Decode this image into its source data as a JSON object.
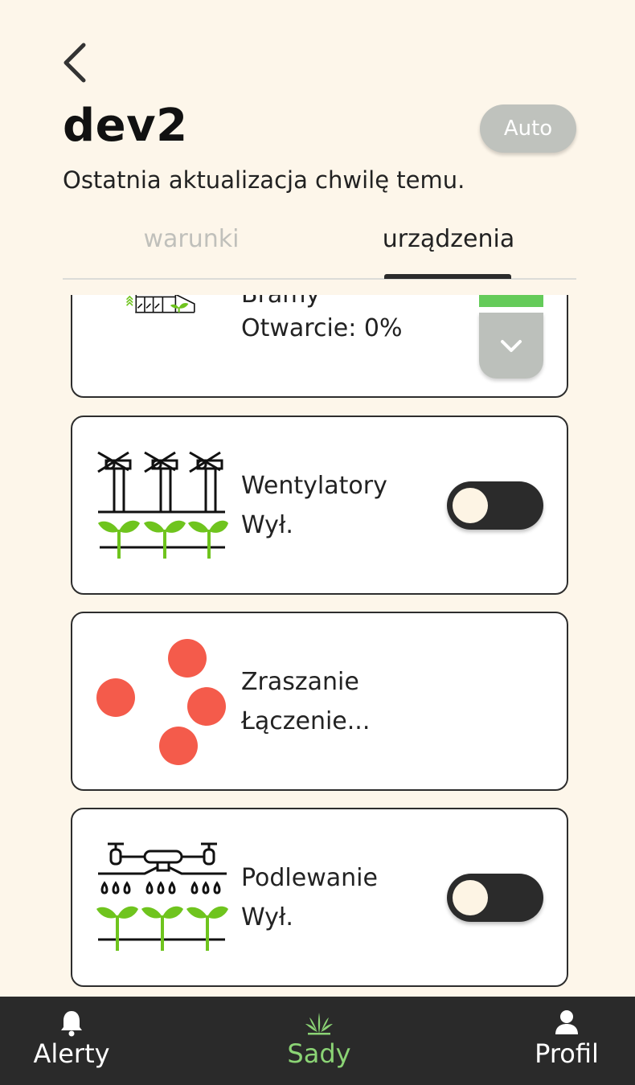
{
  "header": {
    "title": "dev2",
    "mode_button": "Auto",
    "last_update": "Ostatnia aktualizacja chwilę temu."
  },
  "tabs": [
    {
      "label": "warunki",
      "active": false
    },
    {
      "label": "urządzenia",
      "active": true
    }
  ],
  "devices": [
    {
      "name": "Bramy",
      "status": "Otwarcie: 0%",
      "icon": "greenhouse-gate-icon",
      "control": "dropdown"
    },
    {
      "name": "Wentylatory",
      "status": "Wył.",
      "icon": "fans-icon",
      "control": "toggle",
      "on": false
    },
    {
      "name": "Zraszanie",
      "status": "Łączenie...",
      "icon": "loading-dots-icon",
      "control": "none"
    },
    {
      "name": "Podlewanie",
      "status": "Wył.",
      "icon": "irrigation-icon",
      "control": "toggle",
      "on": false
    }
  ],
  "bottom_nav": [
    {
      "label": "Alerty",
      "icon": "bell-icon",
      "active": false
    },
    {
      "label": "Sady",
      "icon": "sprout-icon",
      "active": true
    },
    {
      "label": "Profil",
      "icon": "user-icon",
      "active": false
    }
  ],
  "colors": {
    "background": "#fdf6ea",
    "accent_green": "#64cb59",
    "plant_green": "#6fc41e",
    "loading_red": "#f45b4b",
    "dark": "#2b2b2b",
    "mode_button": "#bfc2bd"
  }
}
